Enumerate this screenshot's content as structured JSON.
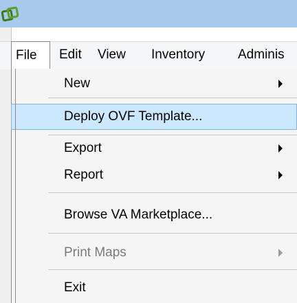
{
  "menubar": {
    "items": [
      {
        "label": "File"
      },
      {
        "label": "Edit"
      },
      {
        "label": "View"
      },
      {
        "label": "Inventory"
      },
      {
        "label": "Adminis"
      }
    ]
  },
  "file_menu": {
    "items": [
      {
        "label": "New",
        "submenu": true,
        "enabled": true
      },
      {
        "label": "Deploy OVF Template...",
        "submenu": false,
        "enabled": true,
        "highlighted": true
      },
      {
        "label": "Export",
        "submenu": true,
        "enabled": true
      },
      {
        "label": "Report",
        "submenu": true,
        "enabled": true
      },
      {
        "label": "Browse VA Marketplace...",
        "submenu": false,
        "enabled": true
      },
      {
        "label": "Print Maps",
        "submenu": true,
        "enabled": false
      },
      {
        "label": "Exit",
        "submenu": false,
        "enabled": true
      }
    ]
  },
  "icons": {
    "app": "vsphere-client-icon",
    "submenu": "submenu-arrow-icon"
  },
  "colors": {
    "titlebar": "#a8c9ec",
    "highlight_fill": "#cce8ff",
    "highlight_border": "#7eb4ea",
    "disabled_text": "#7a7a7a",
    "app_icon": "#5aa02c"
  }
}
